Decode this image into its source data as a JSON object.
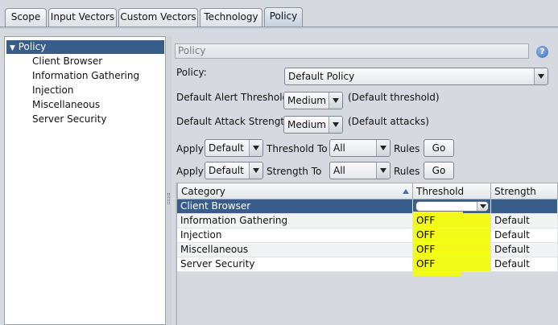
{
  "tabs": [
    {
      "label": "Scope",
      "active": false
    },
    {
      "label": "Input Vectors",
      "active": false
    },
    {
      "label": "Custom Vectors",
      "active": false
    },
    {
      "label": "Technology",
      "active": false
    },
    {
      "label": "Policy",
      "active": true
    }
  ],
  "tree": {
    "root": {
      "label": "Policy",
      "expanded": true,
      "selected": true
    },
    "children": [
      "Client Browser",
      "Information Gathering",
      "Injection",
      "Miscellaneous",
      "Server Security"
    ]
  },
  "panel": {
    "header": "Policy",
    "help_icon": "help-icon",
    "policy_label": "Policy:",
    "policy_value": "Default Policy",
    "alert_threshold_label": "Default Alert Threshold:",
    "alert_threshold_value": "Medium",
    "alert_threshold_note": "(Default threshold)",
    "attack_strength_label": "Default Attack Strength:",
    "attack_strength_value": "Medium",
    "attack_strength_note": "(Default attacks)",
    "apply_threshold": {
      "apply": "Apply",
      "value": "Default",
      "to": "Threshold To",
      "scope": "All",
      "rules": "Rules",
      "go": "Go"
    },
    "apply_strength": {
      "apply": "Apply",
      "value": "Default",
      "to": "Strength To",
      "scope": "All",
      "rules": "Rules",
      "go": "Go"
    }
  },
  "table": {
    "columns": [
      "Category",
      "Threshold",
      "Strength"
    ],
    "sorted_column": "Category",
    "rows": [
      {
        "category": "Client Browser",
        "threshold": "",
        "strength": "",
        "selected": true,
        "editing": true
      },
      {
        "category": "Information Gathering",
        "threshold": "OFF",
        "strength": "Default"
      },
      {
        "category": "Injection",
        "threshold": "OFF",
        "strength": "Default"
      },
      {
        "category": "Miscellaneous",
        "threshold": "OFF",
        "strength": "Default"
      },
      {
        "category": "Server Security",
        "threshold": "OFF",
        "strength": "Default"
      }
    ],
    "highlight_color": "#f4fa18"
  },
  "colors": {
    "selection": "#385d8a",
    "background": "#d6d9df"
  }
}
